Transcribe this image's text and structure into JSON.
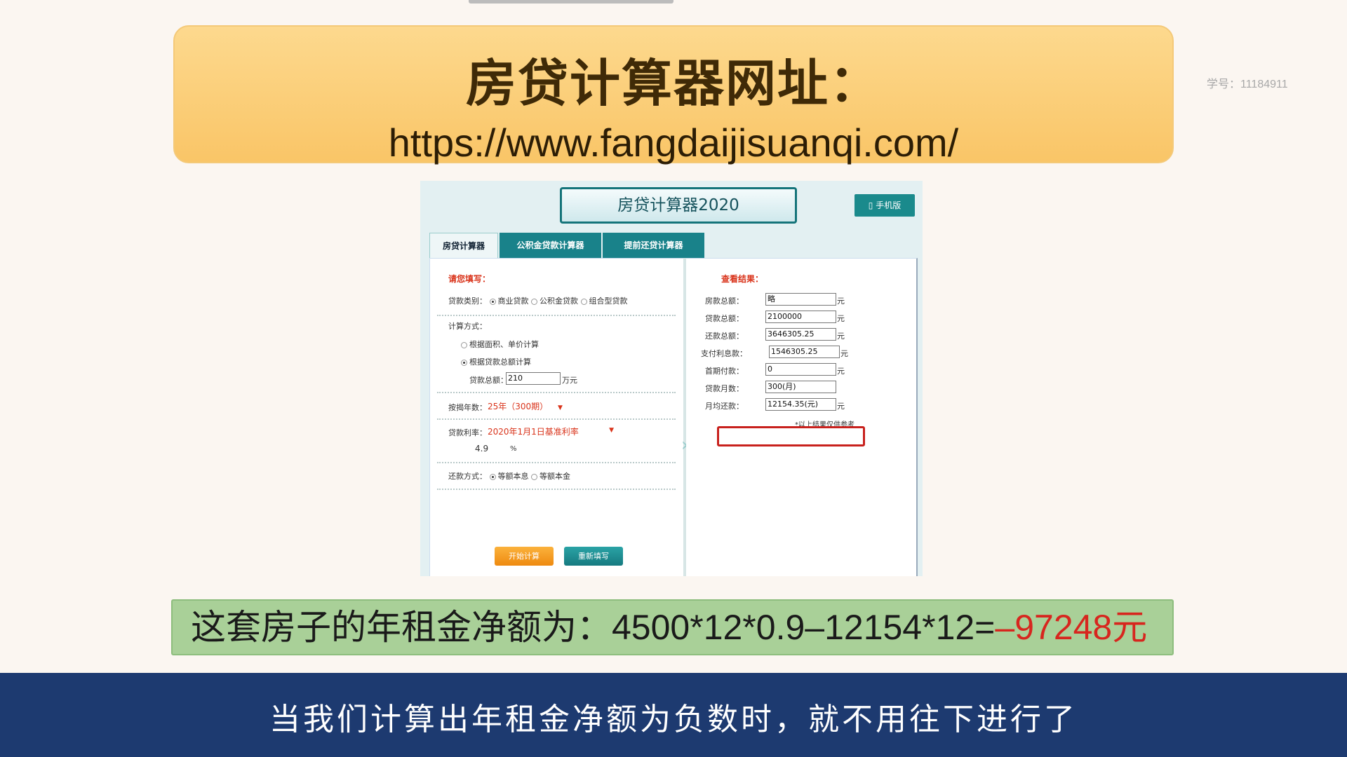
{
  "banner": {
    "title": "房贷计算器网址：",
    "url": "https://www.fangdaijisuanqi.com/"
  },
  "watermark": "学号：11184911",
  "calculator": {
    "header_title": "房贷计算器2020",
    "mobile_button": "手机版",
    "tabs": [
      "房贷计算器2020",
      "公积金贷款计算器",
      "提前还贷计算器"
    ],
    "left": {
      "heading": "请您填写：",
      "loan_type_label": "贷款类别：",
      "loan_type_options": [
        "商业贷款",
        "公积金贷款",
        "组合型贷款"
      ],
      "calc_method_label": "计算方式：",
      "calc_method_options": [
        "根据面积、单价计算",
        "根据贷款总额计算"
      ],
      "loan_total_label": "贷款总额：",
      "loan_total_value": "210",
      "loan_total_unit": "万元",
      "years_label": "按揭年数：",
      "years_value": "25年（300期）",
      "rate_label": "贷款利率：",
      "rate_value": "2020年1月1日基准利率",
      "rate_number": "4.9",
      "rate_unit": "%",
      "repay_label": "还款方式：",
      "repay_options": [
        "等额本息",
        "等额本金"
      ],
      "start_button": "开始计算",
      "reset_button": "重新填写"
    },
    "right": {
      "heading": "查看结果：",
      "rows": [
        {
          "label": "房款总额：",
          "value": "略",
          "unit": "元"
        },
        {
          "label": "贷款总额：",
          "value": "2100000",
          "unit": "元"
        },
        {
          "label": "还款总额：",
          "value": "3646305.25",
          "unit": "元"
        },
        {
          "label": "支付利息款：",
          "value": "1546305.25",
          "unit": "元"
        },
        {
          "label": "首期付款：",
          "value": "0",
          "unit": "元"
        },
        {
          "label": "贷款月数：",
          "value": "300(月)",
          "unit": ""
        },
        {
          "label": "月均还款：",
          "value": "12154.35(元)",
          "unit": "元"
        }
      ],
      "note": "*以上结果仅供参考"
    }
  },
  "formula": {
    "prefix": "这套房子的年租金净额为：4500*12*0.9–12154*12=",
    "result": "–97248元"
  },
  "subtitle": "当我们计算出年租金净额为负数时，就不用往下进行了"
}
